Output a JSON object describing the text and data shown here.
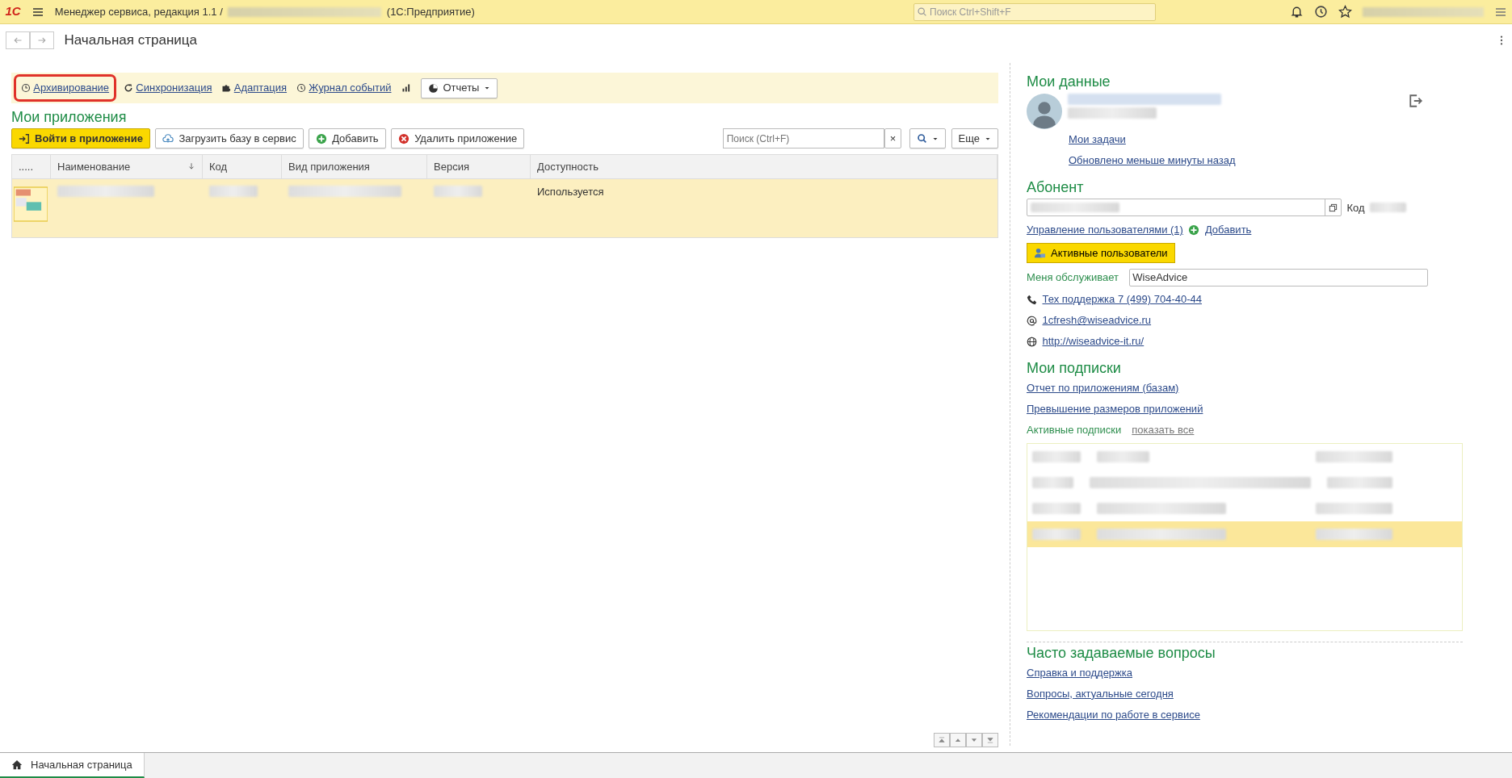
{
  "window": {
    "logo": "1С",
    "title": "Менеджер сервиса, редакция 1.1 /",
    "title_suffix": "(1С:Предприятие)",
    "search_placeholder": "Поиск Ctrl+Shift+F"
  },
  "page": {
    "title": "Начальная страница"
  },
  "toolbar": {
    "links": [
      {
        "label": "Архивирование",
        "kind": "clock",
        "highlighted": true
      },
      {
        "label": "Синхронизация",
        "kind": "refresh",
        "highlighted": false
      },
      {
        "label": "Адаптация",
        "kind": "puzzle",
        "highlighted": false
      },
      {
        "label": "Журнал событий",
        "kind": "history",
        "highlighted": false
      }
    ],
    "reports_button": "Отчеты"
  },
  "apps": {
    "heading": "Мои приложения",
    "buttons": [
      {
        "label": "Войти в приложение",
        "kind": "primary"
      },
      {
        "label": "Загрузить базу в сервис",
        "kind": "upload"
      },
      {
        "label": "Добавить",
        "kind": "add"
      },
      {
        "label": "Удалить приложение",
        "kind": "delete"
      }
    ],
    "search_placeholder": "Поиск (Ctrl+F)",
    "clear_button": "×",
    "more_button": "Еще",
    "table": {
      "columns": [
        {
          "label": ".....",
          "sorted": false
        },
        {
          "label": "Наименование",
          "sorted": true
        },
        {
          "label": "Код",
          "sorted": false
        },
        {
          "label": "Вид приложения",
          "sorted": false
        },
        {
          "label": "Версия",
          "sorted": false
        },
        {
          "label": "Доступность",
          "sorted": false
        }
      ],
      "rows": [
        {
          "availability": "Используется",
          "selected": true
        }
      ]
    }
  },
  "my_data": {
    "heading": "Мои данные",
    "links": [
      "Мои задачи",
      "Обновлено меньше минуты назад"
    ]
  },
  "subscriber": {
    "heading": "Абонент",
    "code_label": "Код",
    "users_link": "Управление пользователями (1)",
    "add_link": "Добавить",
    "active_users_button": "Активные пользователи",
    "served_by_label": "Меня обслуживает",
    "served_by_value": "WiseAdvice",
    "contacts": [
      {
        "kind": "phone",
        "text": "Тех поддержка 7 (499) 704-40-44"
      },
      {
        "kind": "email",
        "text": "1cfresh@wiseadvice.ru"
      },
      {
        "kind": "web",
        "text": "http://wiseadvice-it.ru/"
      }
    ]
  },
  "subscriptions": {
    "heading": "Мои подписки",
    "links": [
      "Отчет по приложениям (базам)",
      "Превышение размеров приложений"
    ],
    "active_label": "Активные подписки",
    "show_all": "показать все",
    "rows": [
      {
        "selected": false
      },
      {
        "selected": false
      },
      {
        "selected": false
      },
      {
        "selected": true
      }
    ]
  },
  "faq": {
    "heading": "Часто задаваемые вопросы",
    "links": [
      "Справка и поддержка",
      "Вопросы, актуальные сегодня",
      "Рекомендации по работе в сервисе"
    ]
  },
  "tabs": [
    {
      "label": "Начальная страница",
      "selected": true
    }
  ]
}
